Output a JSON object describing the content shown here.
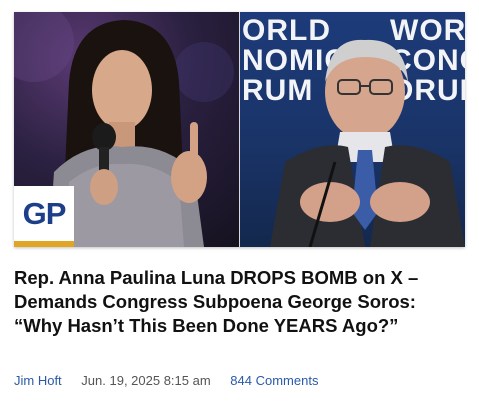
{
  "article": {
    "headline": "Rep. Anna Paulina Luna DROPS BOMB on X – Demands Congress Subpoena George Soros: “Why Hasn’t This Been Done YEARS Ago?”",
    "author": "Jim Hoft",
    "date": "Jun. 19, 2025 8:15 am",
    "comments": "844 Comments"
  },
  "image": {
    "left_subject": "woman-speaking-with-microphone",
    "right_subject": "older-man-speaking-at-forum",
    "background_lettering": [
      "ORLD",
      "NOMIC",
      "RUM",
      "WORLD",
      "CONOMIC",
      "ORUM"
    ]
  },
  "logo": {
    "text": "GP",
    "brand_color": "#1d3f8a",
    "accent_color": "#e0a526"
  }
}
